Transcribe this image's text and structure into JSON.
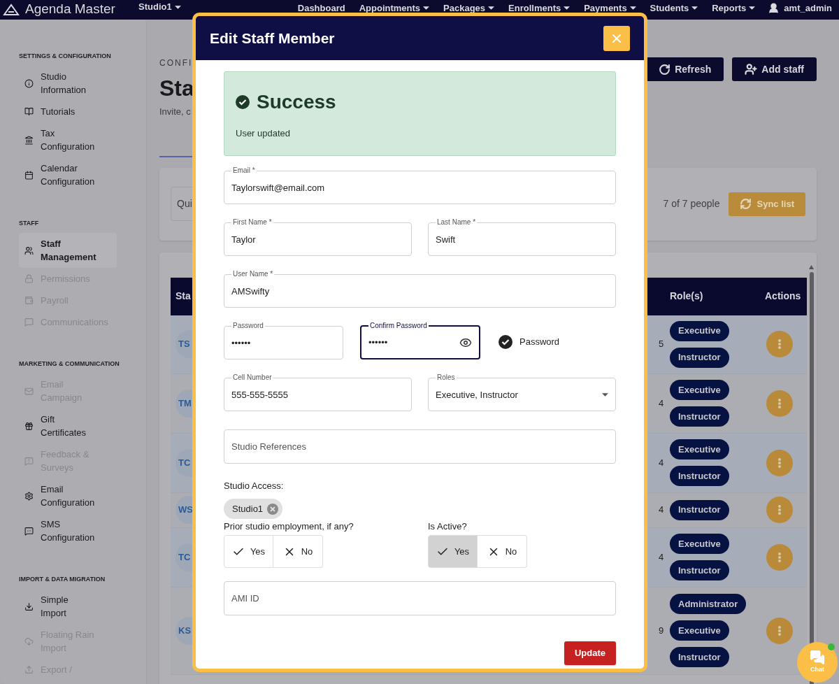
{
  "nav": {
    "brand": "Agenda Master",
    "studio": "Studio1",
    "items": [
      {
        "label": "Dashboard",
        "menu": false
      },
      {
        "label": "Appointments",
        "menu": true
      },
      {
        "label": "Packages",
        "menu": true
      },
      {
        "label": "Enrollments",
        "menu": true
      },
      {
        "label": "Payments",
        "menu": true
      },
      {
        "label": "Students",
        "menu": true
      },
      {
        "label": "Reports",
        "menu": true
      }
    ],
    "user": "amt_admin"
  },
  "sidebar": {
    "sections": [
      {
        "title": "SETTINGS & CONFIGURATION",
        "items": [
          {
            "label": "Studio Information",
            "disabled": false,
            "selected": false
          },
          {
            "label": "Tutorials",
            "disabled": false,
            "selected": false
          },
          {
            "label": "Tax Configuration",
            "disabled": false,
            "selected": false
          },
          {
            "label": "Calendar Configuration",
            "disabled": false,
            "selected": false
          }
        ]
      },
      {
        "title": "STAFF",
        "items": [
          {
            "label": "Staff Management",
            "disabled": false,
            "selected": true
          },
          {
            "label": "Permissions",
            "disabled": true,
            "selected": false
          },
          {
            "label": "Payroll",
            "disabled": true,
            "selected": false
          },
          {
            "label": "Communications",
            "disabled": true,
            "selected": false
          }
        ]
      },
      {
        "title": "MARKETING & COMMUNICATION",
        "items": [
          {
            "label": "Email Campaign",
            "disabled": true,
            "selected": false
          },
          {
            "label": "Gift Certificates",
            "disabled": false,
            "selected": false
          },
          {
            "label": "Feedback & Surveys",
            "disabled": true,
            "selected": false
          },
          {
            "label": "Email Configuration",
            "disabled": false,
            "selected": false
          },
          {
            "label": "SMS Configuration",
            "disabled": false,
            "selected": false
          }
        ]
      },
      {
        "title": "IMPORT & DATA MIGRATION",
        "items": [
          {
            "label": "Simple Import",
            "disabled": false,
            "selected": false
          },
          {
            "label": "Floating Rain Import",
            "disabled": true,
            "selected": false
          },
          {
            "label": "Export /",
            "disabled": true,
            "selected": false
          }
        ]
      }
    ]
  },
  "page": {
    "eyebrow": "CONFI",
    "title": "Sta",
    "subtitle": "Invite, c",
    "buttons": [
      "Refresh",
      "Add staff"
    ],
    "search": {
      "placeholder": "Qui"
    },
    "count": "7 of 7 people",
    "sync": "Sync list",
    "table": {
      "columns": [
        "Sta",
        "Role(s)",
        "Actions"
      ],
      "rows": [
        {
          "initials": "TS",
          "column_2": "5",
          "roles": [
            "Executive",
            "Instructor"
          ]
        },
        {
          "initials": "TM",
          "column_2": "4",
          "roles": [
            "Executive",
            "Instructor"
          ]
        },
        {
          "initials": "TC",
          "column_2": "4",
          "roles": [
            "Executive",
            "Instructor"
          ]
        },
        {
          "initials": "WS",
          "column_2": "4",
          "roles": [
            "Instructor"
          ]
        },
        {
          "initials": "TC",
          "column_2": "4",
          "roles": [
            "Executive",
            "Instructor"
          ]
        },
        {
          "initials": "KS",
          "column_2": "9",
          "roles": [
            "Administrator",
            "Executive",
            "Instructor"
          ]
        }
      ]
    }
  },
  "modal": {
    "title": "Edit Staff Member",
    "alert": {
      "title": "Success",
      "message": "User updated"
    },
    "email": {
      "label": "Email *",
      "value": "Taylorswift@email.com"
    },
    "first_name": {
      "label": "First Name *",
      "value": "Taylor"
    },
    "last_name": {
      "label": "Last Name *",
      "value": "Swift"
    },
    "user_name": {
      "label": "User Name *",
      "value": "AMSwifty"
    },
    "password": {
      "label": "Password",
      "value": "••••••"
    },
    "confirm_password": {
      "label": "Confirm Password",
      "value": "••••••",
      "focused": true
    },
    "password_check": {
      "label": "Password",
      "ok": true
    },
    "cell": {
      "label": "Cell Number",
      "value": "555-555-5555"
    },
    "roles": {
      "label": "Roles",
      "value": "Executive, Instructor"
    },
    "studio_references": {
      "placeholder": "Studio References"
    },
    "studio_access": {
      "label": "Studio Access:",
      "chips": [
        "Studio1"
      ]
    },
    "prior_employment": {
      "label": "Prior studio employment, if any?",
      "options": [
        {
          "label": "Yes",
          "selected": false
        },
        {
          "label": "No",
          "selected": false
        }
      ]
    },
    "is_active": {
      "label": "Is Active?",
      "options": [
        {
          "label": "Yes",
          "selected": true
        },
        {
          "label": "No",
          "selected": false
        }
      ]
    },
    "ami_id": {
      "placeholder": "AMI ID"
    },
    "submit": "Update"
  },
  "chat": {
    "label": "Chat",
    "online": true
  }
}
